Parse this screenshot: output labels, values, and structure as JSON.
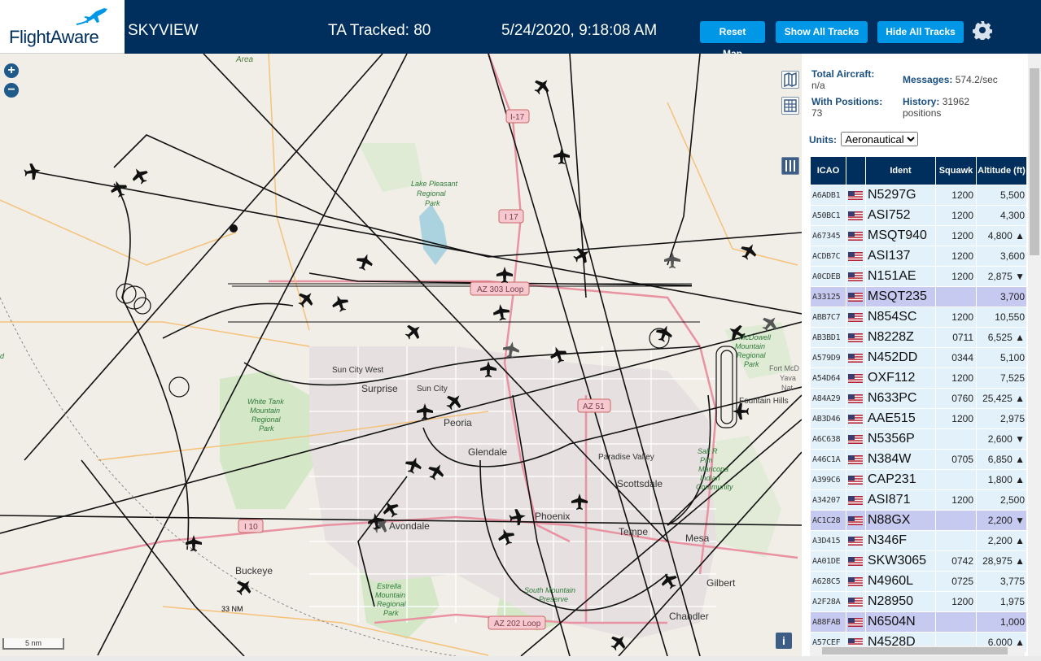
{
  "header": {
    "logo_text": "FlightAware",
    "app_title": "SKYVIEW",
    "tracked": "TA Tracked: 80",
    "datetime": "5/24/2020, 9:18:08 AM",
    "buttons": {
      "reset": "Reset Map",
      "show_all": "Show All Tracks",
      "hide_all": "Hide All Tracks"
    },
    "settings_icon": "gear-icon",
    "brand_color": "#002f5d",
    "button_color": "#0098e6"
  },
  "map": {
    "labels": {
      "area": "Area",
      "i17_top": "I-17",
      "i17_mid": "I 17",
      "lake": "Lake Pleasant",
      "lake2": "Regional",
      "lake3": "Park",
      "az303": "AZ 303 Loop",
      "sun_city_west": "Sun City West",
      "surprise": "Surprise",
      "sun_city": "Sun City",
      "peoria": "Peoria",
      "glendale": "Glendale",
      "white_tank": "White Tank",
      "white_tank2": "Mountain",
      "white_tank3": "Regional",
      "white_tank4": "Park",
      "az51": "AZ 51",
      "paradise_valley": "Paradise Valley",
      "scottsdale": "Scottsdale",
      "phoenix": "Phoenix",
      "tempe": "Tempe",
      "mesa": "Mesa",
      "i10": "I 10",
      "avondale": "Avondale",
      "buckeye": "Buckeye",
      "estrella": "Estrella",
      "estrella2": "Mountain",
      "estrella3": "Regional",
      "estrella4": "Park",
      "south_mountain": "South Mountain",
      "south_mountain2": "Preserve",
      "gilbert": "Gilbert",
      "chandler": "Chandler",
      "az202": "AZ 202 Loop",
      "fountain_hills": "Fountain Hills",
      "mcdowell": "McDowell",
      "mcdowell2": "Mountain",
      "mcdowell3": "Regional",
      "mcdowell4": "Park",
      "salt_river": "Salt R",
      "salt_river2": "Pim",
      "salt_river3": "Maricopa",
      "salt_river4": "Indian",
      "salt_river5": "Community",
      "fort_mcdowell": "Fort McD",
      "fort_mcdowell2": "Yava",
      "fort_mcdowell3": "Nat",
      "range_ring": "33 NM",
      "scale": "5 nm",
      "area_left": "d"
    },
    "zoom_in": "+",
    "zoom_out": "−",
    "info": "i"
  },
  "panel": {
    "total_label": "Total Aircraft:",
    "total_value": "n/a",
    "positions_label": "With Positions:",
    "positions_value": "73",
    "messages_label": "Messages:",
    "messages_value": "574.2/sec",
    "history_label": "History:",
    "history_value": "31962",
    "history_unit": "positions",
    "units_label": "Units:",
    "units_value": "Aeronautical",
    "columns": {
      "icao": "ICAO",
      "ident": "Ident",
      "squawk": "Squawk",
      "altitude": "Altitude (ft)"
    },
    "rows": [
      {
        "icao": "A6ADB1",
        "ident": "N5297G",
        "squawk": "1200",
        "alt": "5,500",
        "sel": false
      },
      {
        "icao": "A50BC1",
        "ident": "ASI752",
        "squawk": "1200",
        "alt": "4,300",
        "sel": false
      },
      {
        "icao": "A67345",
        "ident": "MSQT940",
        "squawk": "1200",
        "alt": "4,800 ▲",
        "sel": false
      },
      {
        "icao": "ACDB7C",
        "ident": "ASI137",
        "squawk": "1200",
        "alt": "3,600",
        "sel": false
      },
      {
        "icao": "A0CDEB",
        "ident": "N151AE",
        "squawk": "1200",
        "alt": "2,875 ▼",
        "sel": false
      },
      {
        "icao": "A33125",
        "ident": "MSQT235",
        "squawk": "",
        "alt": "3,700",
        "sel": true
      },
      {
        "icao": "ABB7C7",
        "ident": "N854SC",
        "squawk": "1200",
        "alt": "10,550",
        "sel": false
      },
      {
        "icao": "AB3BD1",
        "ident": "N8228Z",
        "squawk": "0711",
        "alt": "6,525 ▲",
        "sel": false
      },
      {
        "icao": "A579D9",
        "ident": "N452DD",
        "squawk": "0344",
        "alt": "5,100",
        "sel": false
      },
      {
        "icao": "A54D64",
        "ident": "OXF112",
        "squawk": "1200",
        "alt": "7,525",
        "sel": false
      },
      {
        "icao": "A84A29",
        "ident": "N633PC",
        "squawk": "0760",
        "alt": "25,425 ▲",
        "sel": false
      },
      {
        "icao": "AB3D46",
        "ident": "AAE515",
        "squawk": "1200",
        "alt": "2,975",
        "sel": false
      },
      {
        "icao": "A6C638",
        "ident": "N5356P",
        "squawk": "",
        "alt": "2,600 ▼",
        "sel": false
      },
      {
        "icao": "A46C1A",
        "ident": "N384W",
        "squawk": "0705",
        "alt": "6,850 ▲",
        "sel": false
      },
      {
        "icao": "A399C6",
        "ident": "CAP231",
        "squawk": "",
        "alt": "1,800 ▲",
        "sel": false
      },
      {
        "icao": "A34207",
        "ident": "ASI871",
        "squawk": "1200",
        "alt": "2,500",
        "sel": false
      },
      {
        "icao": "AC1C28",
        "ident": "N88GX",
        "squawk": "",
        "alt": "2,200 ▼",
        "sel": true
      },
      {
        "icao": "A3D415",
        "ident": "N346F",
        "squawk": "",
        "alt": "2,200 ▲",
        "sel": false
      },
      {
        "icao": "AA01DE",
        "ident": "SKW3065",
        "squawk": "0742",
        "alt": "28,975 ▲",
        "sel": false
      },
      {
        "icao": "A628C5",
        "ident": "N4960L",
        "squawk": "0725",
        "alt": "3,775",
        "sel": false
      },
      {
        "icao": "A2F28A",
        "ident": "N28950",
        "squawk": "1200",
        "alt": "1,975",
        "sel": false
      },
      {
        "icao": "A88FAB",
        "ident": "N6504N",
        "squawk": "",
        "alt": "1,000",
        "sel": true
      },
      {
        "icao": "A57CEF",
        "ident": "N4528D",
        "squawk": "",
        "alt": "6,000 ▲",
        "sel": false
      }
    ]
  }
}
